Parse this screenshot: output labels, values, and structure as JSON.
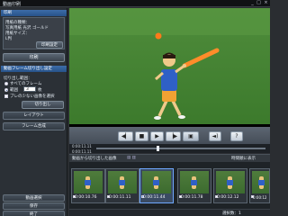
{
  "window": {
    "title": "動画印刷",
    "minimize": "_",
    "maximize": "□",
    "close": "×"
  },
  "print_section": {
    "header": "印刷",
    "info_lines": [
      "用紙の種類：",
      "写真用紙 光沢 ゴールド",
      "用紙サイズ：",
      "L判"
    ],
    "settings_button": "印刷設定",
    "print_button": "印刷"
  },
  "frame_section": {
    "header": "動画フレーム切り出し設定",
    "source_label": "切り出し範囲：",
    "radio_all": "すべてのフレーム",
    "radio_range": "範囲",
    "frame_count": "3",
    "unit": "枚",
    "blur_check": "ブレの少ない画像を選択",
    "cut_button": "切り出し",
    "layout_button": "レイアウト",
    "compose_button": "フレーム合成"
  },
  "footer_buttons": {
    "select_video": "動画選択",
    "save": "保存",
    "exit": "終了"
  },
  "player": {
    "time_start": "0:00:11.11",
    "time_current": "0:00:11.11",
    "capture_icon": "camera-capture-icon",
    "volume_icon": "speaker-icon",
    "help_label": "?"
  },
  "strip": {
    "label": "動画から切り出した画像",
    "show_time_label": "時間順に表示",
    "count_label": "選択数：1",
    "thumbs": [
      {
        "time": "0:00:10.76",
        "selected": false
      },
      {
        "time": "0:00:11.11",
        "selected": false
      },
      {
        "time": "0:00:11.44",
        "selected": true
      },
      {
        "time": "0:00:11.78",
        "selected": false
      },
      {
        "time": "0:00:12.12",
        "selected": false
      },
      {
        "time": "0:00:12",
        "selected": false
      }
    ]
  },
  "colors": {
    "accent": "#2f60c6",
    "header": "#3d6ca8",
    "ball": "#ff7a1a",
    "bat": "#ff8c2a"
  }
}
